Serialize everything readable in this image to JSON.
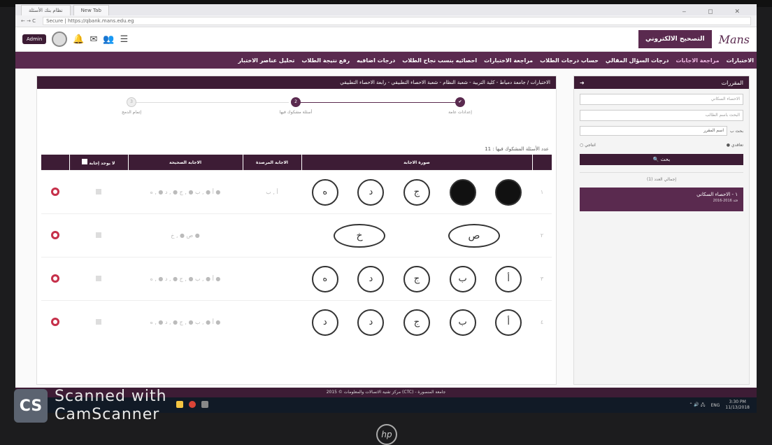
{
  "browser": {
    "tabs": [
      "نظام بنك الأسئلة",
      "New Tab"
    ],
    "address": "Secure | https://qbank.mans.edu.eg"
  },
  "topbar": {
    "user_pill": "Admin",
    "title": "التصحيح الالكتروني",
    "logo": "Mans"
  },
  "nav": {
    "items": [
      "الاختبارات",
      "مراجعة الاجابات",
      "درجات السؤال المقالي",
      "حساب درجات الطلاب",
      "مراجعة الاختبارات",
      "احصائيه بنسب نجاح الطلاب",
      "درجات اضافيه",
      "رفع نتيجة الطلاب",
      "تحليل عناصر الاختبار"
    ]
  },
  "sidebar": {
    "header": "المقررات",
    "input1": "الاحصاء السكاني",
    "input2": "البحث باسم الطالب",
    "select_label": "بحث ب",
    "select_value": "اسم المقرر",
    "radio1": "تعاقدي",
    "radio2": "انتاجي",
    "search_button": "بحث",
    "count": "إجمالي العدد (1)",
    "card_title": "١ - الاحصاء السكاني",
    "card_sub": "2016-2016 فئة"
  },
  "main": {
    "breadcrumb": "الاختبارات / جامعة دمياط - كلية التربية - شعبة النظام - شعبة الاحصاء التطبيقي - رابعة الاحصاء التطبيقي",
    "steps": [
      "إعدادات عامة",
      "أسئلة مشكوك فيها",
      "إتمام الدمج"
    ],
    "count_text": "عدد الأسئلة المشكوك فيها : 11",
    "headers": [
      "",
      "صورة الاجابة",
      "الاجابة المرصدة",
      "الاجابة الصحيحة",
      "لا يوجد إجابة",
      ""
    ],
    "rows": [
      {
        "num": "١",
        "bubbles": [
          "ه",
          "د",
          "ج",
          "",
          ""
        ],
        "filled": [
          false,
          false,
          false,
          true,
          true
        ],
        "recorded": "أ , ب",
        "correct": "أ ● , ب ● , ج ● , د ● , ه ●"
      },
      {
        "num": "٢",
        "ovals": [
          "خ",
          "ص"
        ],
        "recorded": "",
        "correct": "ص ● , خ ●"
      },
      {
        "num": "٣",
        "bubbles": [
          "ه",
          "د",
          "ج",
          "ب",
          "أ"
        ],
        "filled": [
          false,
          false,
          false,
          false,
          false
        ],
        "recorded": "",
        "correct": "أ ● , ب ● , ج ● , د ● , ه ●"
      },
      {
        "num": "٤",
        "bubbles": [
          "د",
          "د",
          "ج",
          "ب",
          "أ"
        ],
        "filled": [
          false,
          false,
          false,
          false,
          false
        ],
        "recorded": "",
        "correct": "أ ● , ب ● , ج ● , د ● , ه ●"
      }
    ]
  },
  "footer": "2015 © مركز تقنية الاتصالات والمعلومات (CTC) - جامعة المنصورة",
  "taskbar": {
    "time": "3:30 PM",
    "date": "11/13/2018",
    "lang": "ENG"
  },
  "scanner": {
    "logo": "CS",
    "line1": "Scanned with",
    "line2": "CamScanner"
  },
  "hp": "hp"
}
